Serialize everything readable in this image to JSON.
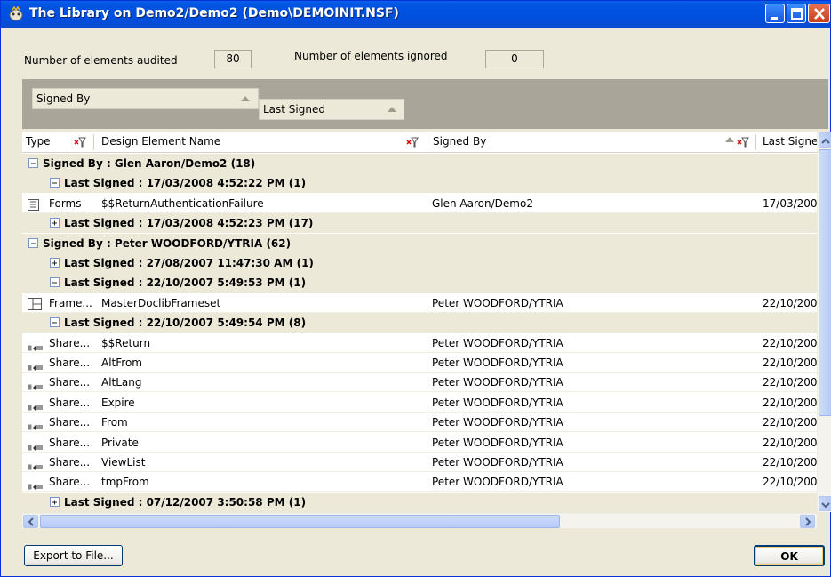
{
  "window": {
    "title": "The Library on Demo2/Demo2 (Demo\\DEMOINIT.NSF)"
  },
  "audit": {
    "audited_label": "Number of elements audited",
    "audited_value": "80",
    "ignored_label": "Number of elements ignored",
    "ignored_value": "0"
  },
  "grouping": {
    "group1": "Signed By",
    "group2": "Last Signed"
  },
  "columns": {
    "type": "Type",
    "name": "Design Element Name",
    "signed_by": "Signed By",
    "last_signed": "Last Signe"
  },
  "rows": [
    {
      "kind": "group",
      "level": 1,
      "expanded": true,
      "text": "Signed By : Glen Aaron/Demo2 (18)"
    },
    {
      "kind": "group",
      "level": 2,
      "expanded": true,
      "text": "Last Signed : 17/03/2008 4:52:22 PM (1)"
    },
    {
      "kind": "data",
      "icon": "form-icon",
      "type": "Forms",
      "name": "$$ReturnAuthenticationFailure",
      "signed_by": "Glen Aaron/Demo2",
      "last": "17/03/200"
    },
    {
      "kind": "group",
      "level": 2,
      "expanded": false,
      "text": "Last Signed : 17/03/2008 4:52:23 PM (17)"
    },
    {
      "kind": "group",
      "level": 1,
      "expanded": true,
      "text": "Signed By : Peter WOODFORD/YTRIA (62)"
    },
    {
      "kind": "group",
      "level": 2,
      "expanded": false,
      "text": "Last Signed : 27/08/2007 11:47:30 AM (1)"
    },
    {
      "kind": "group",
      "level": 2,
      "expanded": true,
      "text": "Last Signed : 22/10/2007 5:49:53 PM (1)"
    },
    {
      "kind": "data",
      "icon": "frameset-icon",
      "type": "Frame...",
      "name": "MasterDoclibFrameset",
      "signed_by": "Peter WOODFORD/YTRIA",
      "last": "22/10/200"
    },
    {
      "kind": "group",
      "level": 2,
      "expanded": true,
      "text": "Last Signed : 22/10/2007 5:49:54 PM (8)"
    },
    {
      "kind": "data",
      "icon": "shared-field-icon",
      "type": "Share...",
      "name": "$$Return",
      "signed_by": "Peter WOODFORD/YTRIA",
      "last": "22/10/200"
    },
    {
      "kind": "data",
      "icon": "shared-field-icon",
      "type": "Share...",
      "name": "AltFrom",
      "signed_by": "Peter WOODFORD/YTRIA",
      "last": "22/10/200"
    },
    {
      "kind": "data",
      "icon": "shared-field-icon",
      "type": "Share...",
      "name": "AltLang",
      "signed_by": "Peter WOODFORD/YTRIA",
      "last": "22/10/200"
    },
    {
      "kind": "data",
      "icon": "shared-field-icon",
      "type": "Share...",
      "name": "Expire",
      "signed_by": "Peter WOODFORD/YTRIA",
      "last": "22/10/200"
    },
    {
      "kind": "data",
      "icon": "shared-field-icon",
      "type": "Share...",
      "name": "From",
      "signed_by": "Peter WOODFORD/YTRIA",
      "last": "22/10/200"
    },
    {
      "kind": "data",
      "icon": "shared-field-icon",
      "type": "Share...",
      "name": "Private",
      "signed_by": "Peter WOODFORD/YTRIA",
      "last": "22/10/200"
    },
    {
      "kind": "data",
      "icon": "shared-field-icon",
      "type": "Share...",
      "name": "ViewList",
      "signed_by": "Peter WOODFORD/YTRIA",
      "last": "22/10/200"
    },
    {
      "kind": "data",
      "icon": "shared-field-icon",
      "type": "Share...",
      "name": "tmpFrom",
      "signed_by": "Peter WOODFORD/YTRIA",
      "last": "22/10/200"
    },
    {
      "kind": "group",
      "level": 2,
      "expanded": false,
      "text": "Last Signed : 07/12/2007 3:50:58 PM (1)"
    }
  ],
  "buttons": {
    "export": "Export to File...",
    "ok": "OK"
  },
  "colors": {
    "title_bar": "#0053E1",
    "dialog_bg": "#ECE9D8",
    "group_area": "#A9A699"
  }
}
